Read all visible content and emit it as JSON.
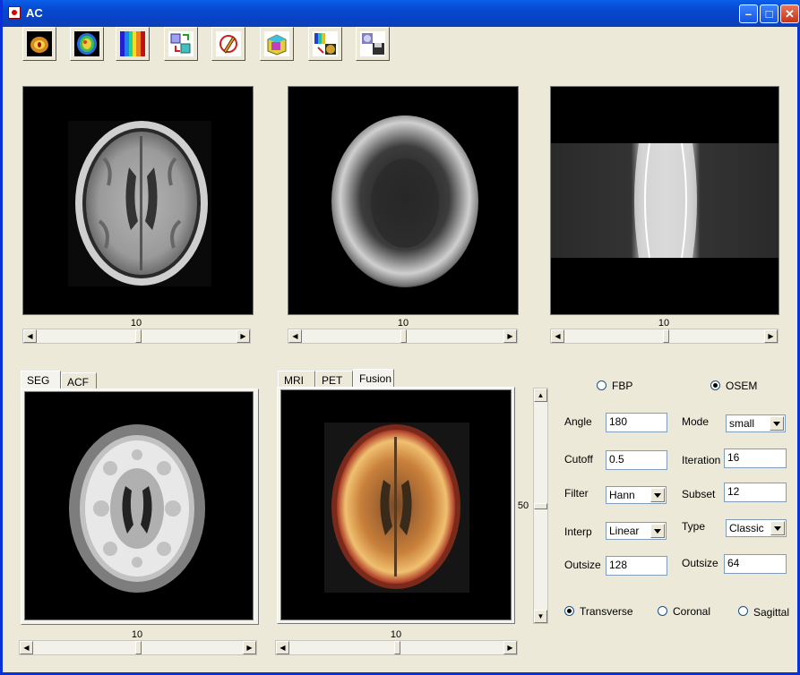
{
  "window": {
    "title": "AC"
  },
  "toolbar": {
    "buttons": [
      {
        "icon": "brain-ct-icon"
      },
      {
        "icon": "brain-pet-icon"
      },
      {
        "icon": "colormap-icon"
      },
      {
        "icon": "cube-transform-icon"
      },
      {
        "icon": "edit-icon"
      },
      {
        "icon": "volume-render-icon"
      },
      {
        "icon": "fusion-icon"
      },
      {
        "icon": "save-icon"
      }
    ]
  },
  "top_panels": [
    {
      "name": "mri",
      "slider_value": "10",
      "slider_fraction": 0.5
    },
    {
      "name": "pet",
      "slider_value": "10",
      "slider_fraction": 0.5
    },
    {
      "name": "sinogram",
      "slider_value": "10",
      "slider_fraction": 0.5
    }
  ],
  "seg_panel": {
    "tabs": [
      "SEG",
      "ACF"
    ],
    "active_tab": "SEG",
    "slider_value": "10"
  },
  "fusion_panel": {
    "tabs": [
      "MRI",
      "PET",
      "Fusion"
    ],
    "active_tab": "Fusion",
    "slider_value": "10",
    "vslider_value": "50"
  },
  "recon": {
    "method_fbp": "FBP",
    "method_osem": "OSEM",
    "selected_method": "OSEM",
    "angle_label": "Angle",
    "angle_value": "180",
    "cutoff_label": "Cutoff",
    "cutoff_value": "0.5",
    "filter_label": "Filter",
    "filter_value": "Hann",
    "interp_label": "Interp",
    "interp_value": "Linear",
    "outsize_label": "Outsize",
    "outsize_value": "128",
    "mode_label": "Mode",
    "mode_value": "small",
    "iteration_label": "Iteration",
    "iteration_value": "16",
    "subset_label": "Subset",
    "subset_value": "12",
    "type_label": "Type",
    "type_value": "Classic",
    "outsize2_label": "Outsize",
    "outsize2_value": "64"
  },
  "view": {
    "transverse": "Transverse",
    "coronal": "Coronal",
    "sagittal": "Sagittal",
    "selected": "Transverse"
  }
}
